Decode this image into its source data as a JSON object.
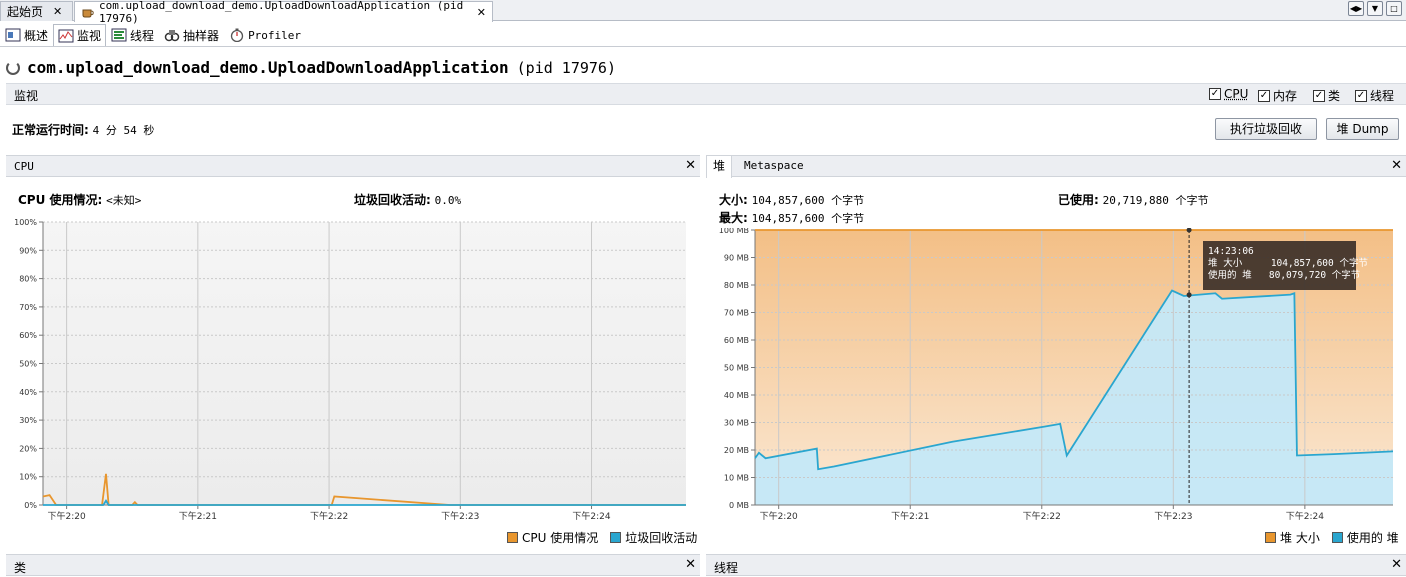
{
  "doc_tabs": {
    "start": "起始页",
    "app": "com.upload_download_demo.UploadDownloadApplication (pid 17976)",
    "close": "✕"
  },
  "sub_tabs": {
    "overview": "概述",
    "monitor": "监视",
    "threads": "线程",
    "sampler": "抽样器",
    "profiler": "Profiler"
  },
  "title": {
    "app": "com.upload_download_demo.UploadDownloadApplication",
    "pid": "(pid 17976)"
  },
  "monitor_bar": {
    "label": "监视",
    "checkboxes": {
      "cpu": "CPU",
      "memory": "内存",
      "classes": "类",
      "threads": "线程"
    }
  },
  "uptime": {
    "label": "正常运行时间:",
    "value": "4 分 54 秒"
  },
  "buttons": {
    "gc": "执行垃圾回收",
    "heap_dump": "堆 Dump"
  },
  "cpu_panel": {
    "title": "CPU",
    "usage_label": "CPU 使用情况:",
    "usage_value": "<未知>",
    "gc_label": "垃圾回收活动:",
    "gc_value": "0.0%",
    "legend": {
      "cpu": "CPU 使用情况",
      "gc": "垃圾回收活动"
    }
  },
  "heap_panel": {
    "tab_heap": "堆",
    "tab_metaspace": "Metaspace",
    "size_label": "大小:",
    "size_value": "104,857,600 个字节",
    "max_label": "最大:",
    "max_value": "104,857,600 个字节",
    "used_label": "已使用:",
    "used_value": "20,719,880 个字节",
    "tooltip": {
      "time": "14:23:06",
      "line1": "堆 大小     104,857,600 个字节",
      "line2": "使用的 堆   80,079,720 个字节"
    },
    "legend": {
      "size": "堆 大小",
      "used": "使用的 堆"
    }
  },
  "bottom": {
    "classes": "类",
    "threads": "线程"
  },
  "colors": {
    "cpu": "#e8962e",
    "gc": "#2aa6cf",
    "heap_size": "#e8962e",
    "heap_used": "#2aa6cf"
  },
  "chart_data": [
    {
      "type": "line",
      "title": "",
      "x": [
        "下午2:20",
        "下午2:21",
        "下午2:22",
        "下午2:23",
        "下午2:24"
      ],
      "ylim": [
        0,
        100
      ],
      "y_ticks": [
        "0%",
        "10%",
        "20%",
        "30%",
        "40%",
        "50%",
        "60%",
        "70%",
        "80%",
        "90%",
        "100%"
      ],
      "x_range_minutes": [
        0,
        4.9
      ],
      "series": [
        {
          "name": "CPU 使用情况",
          "points": [
            [
              0,
              3
            ],
            [
              0.05,
              3.5
            ],
            [
              0.1,
              0
            ],
            [
              0.45,
              0
            ],
            [
              0.48,
              11
            ],
            [
              0.5,
              0
            ],
            [
              0.68,
              0
            ],
            [
              0.7,
              1
            ],
            [
              0.72,
              0
            ],
            [
              2.2,
              0
            ],
            [
              2.22,
              3
            ],
            [
              3.1,
              0
            ],
            [
              4.9,
              0
            ]
          ]
        },
        {
          "name": "垃圾回收活动",
          "points": [
            [
              0,
              0
            ],
            [
              0.46,
              0
            ],
            [
              0.48,
              1.5
            ],
            [
              0.5,
              0
            ],
            [
              4.9,
              0
            ]
          ]
        }
      ],
      "grid": true,
      "legend": "bottom-right"
    },
    {
      "type": "area",
      "title": "",
      "x": [
        "下午2:20",
        "下午2:21",
        "下午2:22",
        "下午2:23",
        "下午2:24"
      ],
      "ylim": [
        0,
        100
      ],
      "y_ticks": [
        "0 MB",
        "10 MB",
        "20 MB",
        "30 MB",
        "40 MB",
        "50 MB",
        "60 MB",
        "70 MB",
        "80 MB",
        "90 MB",
        "100 MB"
      ],
      "x_range_minutes": [
        0,
        4.85
      ],
      "series": [
        {
          "name": "堆 大小",
          "points": [
            [
              0,
              100
            ],
            [
              4.85,
              100
            ]
          ]
        },
        {
          "name": "使用的 堆",
          "points": [
            [
              0,
              17
            ],
            [
              0.03,
              19
            ],
            [
              0.08,
              17
            ],
            [
              0.47,
              20.5
            ],
            [
              0.48,
              13
            ],
            [
              0.6,
              14
            ],
            [
              1.5,
              23
            ],
            [
              2.2,
              28.5
            ],
            [
              2.32,
              29.5
            ],
            [
              2.37,
              18
            ],
            [
              3.17,
              78
            ],
            [
              3.26,
              76
            ],
            [
              3.5,
              77
            ],
            [
              3.55,
              75
            ],
            [
              4.07,
              76.5
            ],
            [
              4.1,
              77
            ],
            [
              4.12,
              18
            ],
            [
              4.4,
              18.5
            ],
            [
              4.85,
              19.5
            ]
          ]
        }
      ],
      "grid": true,
      "legend": "bottom-right"
    }
  ]
}
